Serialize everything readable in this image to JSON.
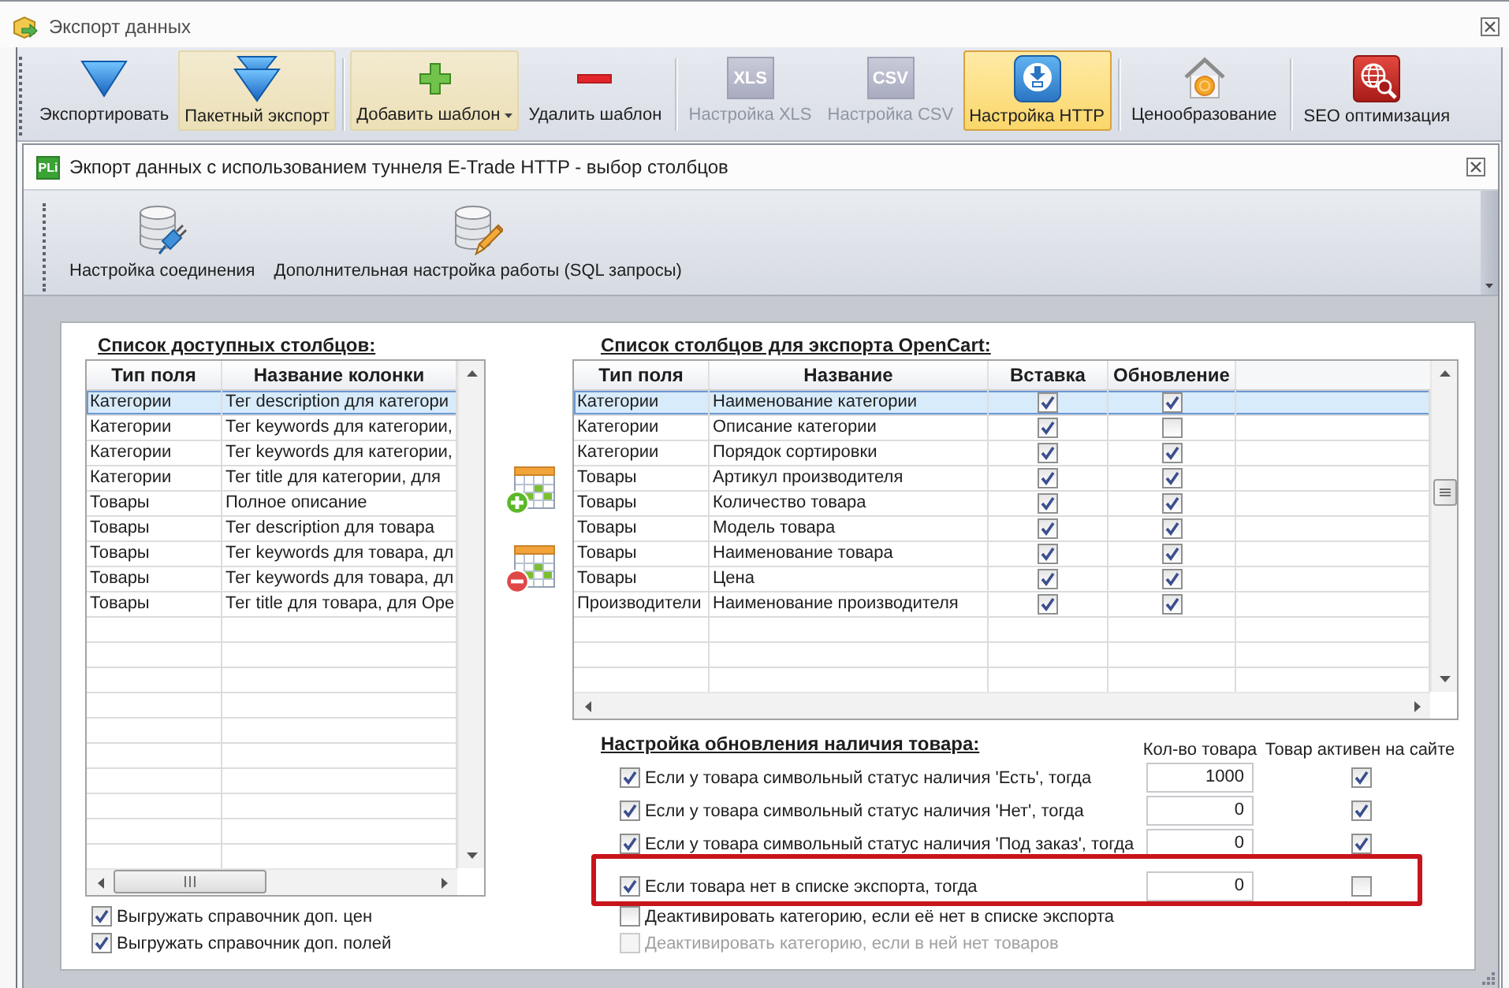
{
  "window": {
    "title": "Экспорт данных"
  },
  "toolbar": {
    "groups": [
      {
        "buttons": [
          {
            "kind": "export",
            "label": "Экспортировать",
            "selected": false,
            "highlighted": false,
            "disabled": false,
            "dropdown": false
          },
          {
            "kind": "batch",
            "label": "Пакетный экспорт",
            "selected": false,
            "highlighted": true,
            "disabled": false,
            "dropdown": false
          }
        ]
      },
      {
        "buttons": [
          {
            "kind": "add",
            "label": "Добавить шаблон",
            "selected": false,
            "highlighted": true,
            "disabled": false,
            "dropdown": true
          },
          {
            "kind": "remove",
            "label": "Удалить шаблон",
            "selected": false,
            "highlighted": false,
            "disabled": false,
            "dropdown": false
          }
        ]
      },
      {
        "buttons": [
          {
            "kind": "format",
            "badge": "XLS",
            "label": "Настройка XLS",
            "selected": false,
            "highlighted": false,
            "disabled": true,
            "dropdown": false
          },
          {
            "kind": "format",
            "badge": "CSV",
            "label": "Настройка CSV",
            "selected": false,
            "highlighted": false,
            "disabled": true,
            "dropdown": false
          },
          {
            "kind": "http",
            "label": "Настройка HTTP",
            "selected": true,
            "highlighted": false,
            "disabled": false,
            "dropdown": false
          }
        ]
      },
      {
        "buttons": [
          {
            "kind": "pricing",
            "label": "Ценообразование",
            "selected": false,
            "highlighted": false,
            "disabled": false,
            "dropdown": false
          }
        ]
      },
      {
        "buttons": [
          {
            "kind": "seo",
            "label": "SEO оптимизация",
            "selected": false,
            "highlighted": false,
            "disabled": false,
            "dropdown": false
          }
        ]
      }
    ]
  },
  "dialog": {
    "logo": "PLi",
    "title": "Экпорт данных с использованием туннеля E-Trade HTTP - выбор столбцов",
    "toolbar": [
      {
        "kind": "connection",
        "label": "Настройка соединения"
      },
      {
        "kind": "sql",
        "label": "Дополнительная настройка работы (SQL запросы)"
      }
    ]
  },
  "available_columns": {
    "title": "Список доступных столбцов:",
    "columns": [
      "Тип поля",
      "Название колонки"
    ],
    "rows": [
      {
        "type": "Категории",
        "name": "Тег description для категори",
        "selected": true
      },
      {
        "type": "Категории",
        "name": "Тег keywords для категории,",
        "selected": false
      },
      {
        "type": "Категории",
        "name": "Тег keywords для категории,",
        "selected": false
      },
      {
        "type": "Категории",
        "name": "Тег title для категории, для",
        "selected": false
      },
      {
        "type": "Товары",
        "name": "Полное описание",
        "selected": false
      },
      {
        "type": "Товары",
        "name": "Тег description для товара",
        "selected": false
      },
      {
        "type": "Товары",
        "name": "Тег keywords для товара, дл",
        "selected": false
      },
      {
        "type": "Товары",
        "name": "Тег keywords для товара, дл",
        "selected": false
      },
      {
        "type": "Товары",
        "name": "Тег title для товара, для Ope",
        "selected": false
      }
    ],
    "options": [
      {
        "label": "Выгружать справочник доп. цен",
        "checked": true
      },
      {
        "label": "Выгружать справочник доп. полей",
        "checked": true
      }
    ]
  },
  "export_columns": {
    "title": "Список столбцов для экспорта OpenCart:",
    "columns": [
      "Тип поля",
      "Название",
      "Вставка",
      "Обновление"
    ],
    "rows": [
      {
        "type": "Категории",
        "name": "Наименование категории",
        "insert": true,
        "update": true,
        "selected": true
      },
      {
        "type": "Категории",
        "name": "Описание категории",
        "insert": true,
        "update": false,
        "selected": false
      },
      {
        "type": "Категории",
        "name": "Порядок сортировки",
        "insert": true,
        "update": true,
        "selected": false
      },
      {
        "type": "Товары",
        "name": "Артикул производителя",
        "insert": true,
        "update": true,
        "selected": false
      },
      {
        "type": "Товары",
        "name": "Количество товара",
        "insert": true,
        "update": true,
        "selected": false
      },
      {
        "type": "Товары",
        "name": "Модель товара",
        "insert": true,
        "update": true,
        "selected": false
      },
      {
        "type": "Товары",
        "name": "Наименование товара",
        "insert": true,
        "update": true,
        "selected": false
      },
      {
        "type": "Товары",
        "name": "Цена",
        "insert": true,
        "update": true,
        "selected": false
      },
      {
        "type": "Производители",
        "name": "Наименование производителя",
        "insert": true,
        "update": true,
        "selected": false
      }
    ]
  },
  "availability": {
    "title": "Настройка обновления наличия товара:",
    "columns": [
      "Кол-во товара",
      "Товар активен на сайте"
    ],
    "rows": [
      {
        "kind": "rule",
        "label": "Если у товара символьный статус наличия 'Есть', тогда",
        "checked": true,
        "disabled": false,
        "quantity": "1000",
        "active": true,
        "highlighted": false
      },
      {
        "kind": "rule",
        "label": "Если у товара символьный статус наличия 'Нет', тогда",
        "checked": true,
        "disabled": false,
        "quantity": "0",
        "active": true,
        "highlighted": false
      },
      {
        "kind": "rule",
        "label": "Если у товара символьный статус наличия 'Под заказ', тогда",
        "checked": true,
        "disabled": false,
        "quantity": "0",
        "active": true,
        "highlighted": false
      },
      {
        "kind": "rule",
        "label": "Если товара нет в списке экспорта, тогда",
        "checked": true,
        "disabled": false,
        "quantity": "0",
        "active": false,
        "highlighted": true
      },
      {
        "kind": "option",
        "label": "Деактивировать категорию, если её нет в списке экспорта",
        "checked": false,
        "disabled": false,
        "highlighted": false
      },
      {
        "kind": "option",
        "label": "Деактивировать категорию, если в ней нет товаров",
        "checked": false,
        "disabled": true,
        "highlighted": false
      }
    ]
  }
}
